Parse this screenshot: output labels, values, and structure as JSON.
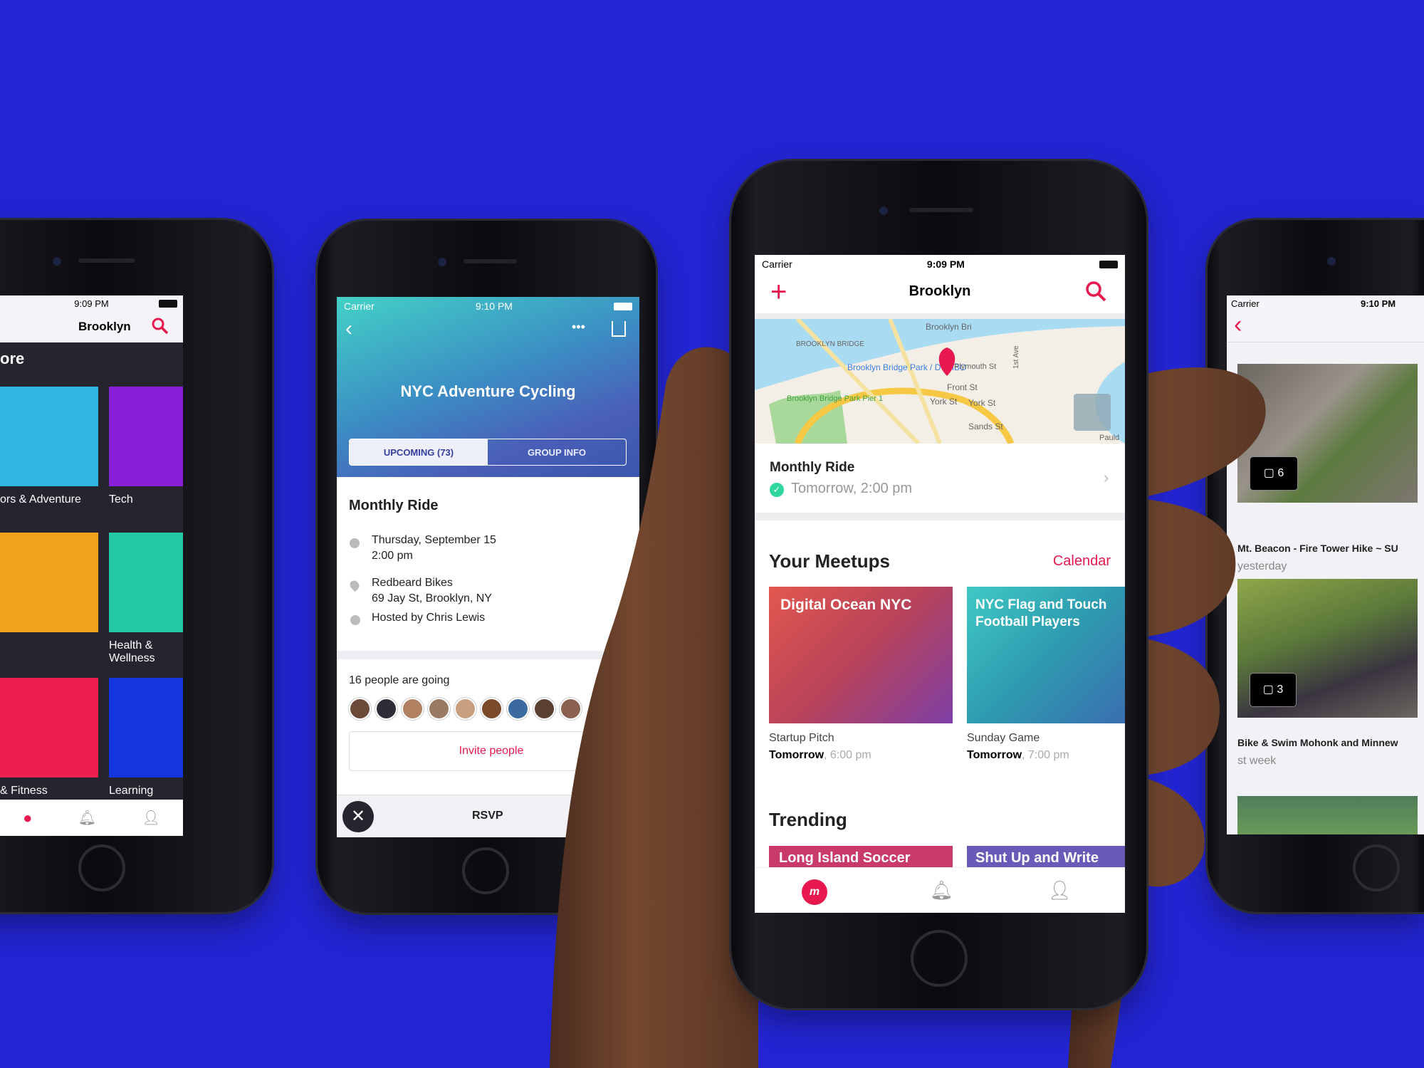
{
  "colors": {
    "background": "#2325d2",
    "accent": "#e8194f",
    "success": "#2fd6a0"
  },
  "phone_explore": {
    "status_time": "9:09 PM",
    "title": "Brooklyn",
    "search_icon": "search-icon",
    "heading": "ore",
    "categories": [
      {
        "label": "ors & Adventure",
        "color": "#2fb6e0"
      },
      {
        "label": "Tech",
        "color": "#8a1fd8"
      },
      {
        "label": "",
        "color": "#f0a21a"
      },
      {
        "label": "Health & Wellness",
        "color": "#22c9a6"
      },
      {
        "label": "& Fitness",
        "color": "#f01e4e"
      },
      {
        "label": "Learning",
        "color": "#1436e0"
      }
    ],
    "tabs": [
      "meetup-logo-icon",
      "bell-icon",
      "profile-icon"
    ]
  },
  "phone_group": {
    "status_carrier": "Carrier",
    "status_time": "9:10 PM",
    "group_name": "NYC Adventure Cycling",
    "segments": [
      "UPCOMING (73)",
      "GROUP INFO"
    ],
    "event_title": "Monthly Ride",
    "date": "Thursday, September 15",
    "time": "2:00 pm",
    "venue": "Redbeard Bikes",
    "address": "69 Jay St, Brooklyn, NY",
    "host": "Hosted by Chris Lewis",
    "going": "16 people are going",
    "invite": "Invite people",
    "rsvp": "RSVP"
  },
  "phone_home": {
    "status_carrier": "Carrier",
    "status_time": "9:09 PM",
    "title": "Brooklyn",
    "map_labels": [
      "BROOKLYN BRIDGE",
      "Brooklyn Bridge Park / DUMBO",
      "Brooklyn Bridge Park Pier 1",
      "Front St",
      "York St",
      "York St",
      "Sands St",
      "1st Ave",
      "Brooklyn Bri",
      "Plymouth St",
      "Pauld"
    ],
    "next_event": {
      "title": "Monthly Ride",
      "when": "Tomorrow, 2:00 pm"
    },
    "your_meetups": "Your Meetups",
    "calendar": "Calendar",
    "meetups": [
      {
        "group": "Digital Ocean NYC",
        "event": "Startup Pitch",
        "day": "Tomorrow",
        "time": ", 6:00 pm"
      },
      {
        "group": "NYC Flag and Touch Football Players",
        "event": "Sunday Game",
        "day": "Tomorrow",
        "time": ", 7:00 pm"
      }
    ],
    "trending": "Trending",
    "trending_items": [
      "Long Island Soccer",
      "Shut Up and Write"
    ]
  },
  "phone_photos": {
    "status_carrier": "Carrier",
    "status_time": "9:10 PM",
    "albums": [
      {
        "title": "Mt. Beacon - Fire Tower Hike ~ SU",
        "when": "yesterday",
        "count": "6"
      },
      {
        "title": "Bike & Swim Mohonk and Minnew",
        "when": "st week",
        "count": "3"
      }
    ]
  }
}
